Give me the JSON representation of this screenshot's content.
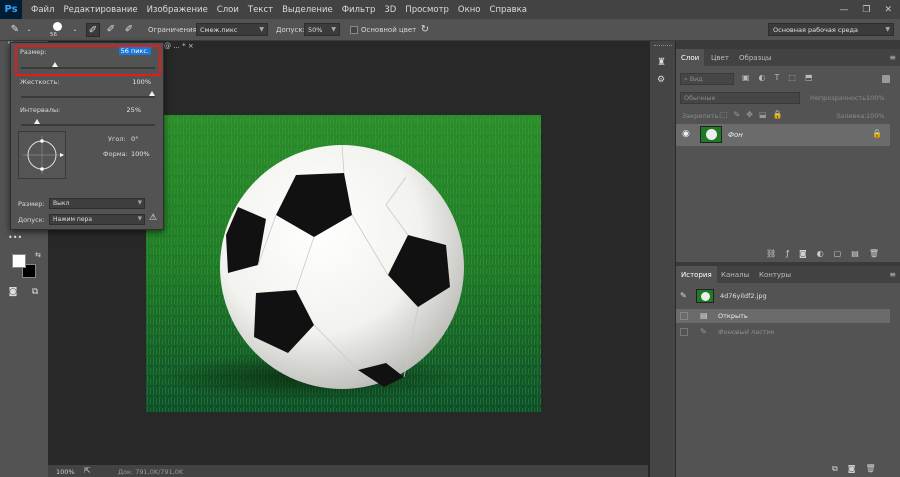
{
  "app": {
    "logo": "Ps"
  },
  "menu": [
    "Файл",
    "Редактирование",
    "Изображение",
    "Слои",
    "Текст",
    "Выделение",
    "Фильтр",
    "3D",
    "Просмотр",
    "Окно",
    "Справка"
  ],
  "options_bar": {
    "brush_size": "56",
    "limits_label": "Ограничения:",
    "limits_value": "Смеж.пикс",
    "tolerance_label": "Допуск:",
    "tolerance_value": "50%",
    "protect_label": "Основной цвет",
    "workspace": "Основная рабочая среда"
  },
  "brush_popup": {
    "size_label": "Размер:",
    "size_value": "56 пикс.",
    "size_fraction": 0.25,
    "hardness_label": "Жесткость:",
    "hardness_value": "100%",
    "spacing_label": "Интервалы:",
    "spacing_value": "25%",
    "angle_label": "Угол:",
    "angle_value": "0°",
    "roundness_label": "Форма:",
    "roundness_value": "100%",
    "size_control_label": "Размер:",
    "size_control_value": "Выкл",
    "tolerance_control_label": "Допуск:",
    "tolerance_control_value": "Нажим пера"
  },
  "document": {
    "tab_fragment": "@ ... * ×"
  },
  "status_bar": {
    "zoom": "100%",
    "doc_info": "Док: 791,0K/791,0K"
  },
  "layers_panel": {
    "tabs": [
      "Слои",
      "Цвет",
      "Образцы"
    ],
    "filter_kind": "Вид",
    "blend_mode": "Обычные",
    "opacity_label": "Непрозрачность:",
    "opacity_value": "100%",
    "lock_label": "Закрепить:",
    "fill_label": "Заливка:",
    "fill_value": "100%",
    "layer_name": "Фон"
  },
  "history_panel": {
    "tabs": [
      "История",
      "Каналы",
      "Контуры"
    ],
    "snapshot_name": "4d76yildf2.jpg",
    "steps": [
      "Открыть",
      "Фоновый ластик"
    ]
  },
  "colors": {
    "foreground": "#ffffff",
    "background": "#000000",
    "highlight_border": "#e01d1d",
    "selection_blue": "#1877d6"
  }
}
